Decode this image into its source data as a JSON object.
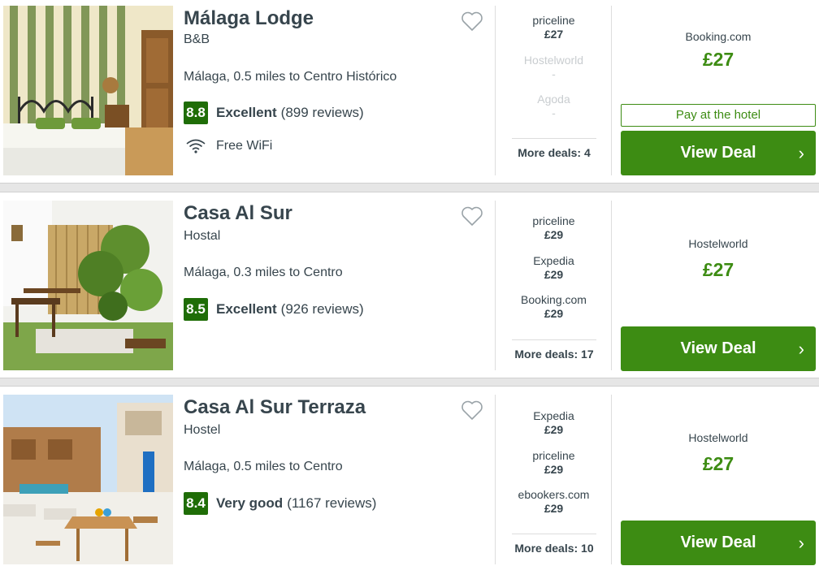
{
  "hotels": [
    {
      "name": "Málaga Lodge",
      "type": "B&B",
      "location": "Málaga, 0.5 miles to Centro Histórico",
      "score": "8.8",
      "rating_word": "Excellent",
      "reviews": "(899 reviews)",
      "amenity": "Free WiFi",
      "deals": [
        {
          "provider": "priceline",
          "price": "£27"
        },
        {
          "provider": "Hostelworld",
          "price": "-"
        },
        {
          "provider": "Agoda",
          "price": "-"
        }
      ],
      "more_deals": "More deals: 4",
      "best_provider": "Booking.com",
      "best_price": "£27",
      "pay_label": "Pay at the hotel",
      "view_deal": "View Deal"
    },
    {
      "name": "Casa Al Sur",
      "type": "Hostal",
      "location": "Málaga, 0.3 miles to Centro",
      "score": "8.5",
      "rating_word": "Excellent",
      "reviews": "(926 reviews)",
      "deals": [
        {
          "provider": "priceline",
          "price": "£29"
        },
        {
          "provider": "Expedia",
          "price": "£29"
        },
        {
          "provider": "Booking.com",
          "price": "£29"
        }
      ],
      "more_deals": "More deals: 17",
      "best_provider": "Hostelworld",
      "best_price": "£27",
      "view_deal": "View Deal"
    },
    {
      "name": "Casa Al Sur Terraza",
      "type": "Hostel",
      "location": "Málaga, 0.5 miles to Centro",
      "score": "8.4",
      "rating_word": "Very good",
      "reviews": "(1167 reviews)",
      "deals": [
        {
          "provider": "Expedia",
          "price": "£29"
        },
        {
          "provider": "priceline",
          "price": "£29"
        },
        {
          "provider": "ebookers.com",
          "price": "£29"
        }
      ],
      "more_deals": "More deals: 10",
      "best_provider": "Hostelworld",
      "best_price": "£27",
      "view_deal": "View Deal"
    }
  ],
  "icons": {
    "favorite": "heart-outline-icon",
    "wifi": "wifi-icon",
    "chevron": "chevron-right-icon"
  },
  "colors": {
    "accent_green": "#3d8c13",
    "score_green": "#1f6d07",
    "text": "#37454d",
    "dim_text": "#c9cdd0"
  }
}
